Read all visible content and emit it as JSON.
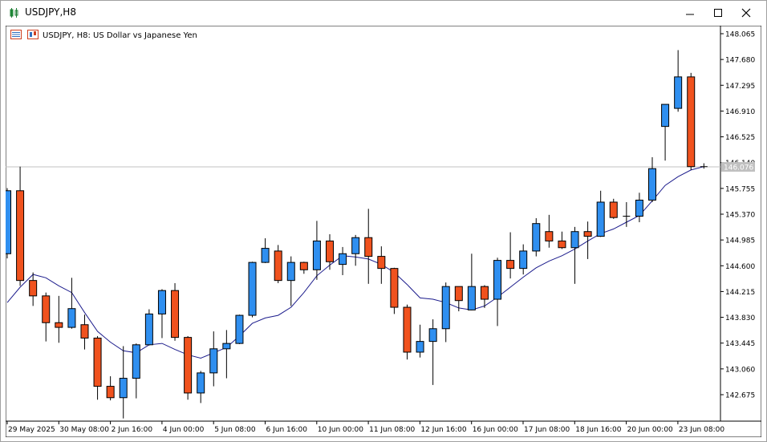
{
  "window": {
    "title": "USDJPY,H8"
  },
  "chart_header": {
    "text": "USDJPY, H8:  US Dollar vs Japanese Yen"
  },
  "colors": {
    "bull": "#2f8ff0",
    "bear": "#f0521e",
    "candle_outline": "#000000",
    "ma_line": "#1c1c8c",
    "price_line": "#c0c0c0",
    "price_tag_bg": "#c0c0c0",
    "price_tag_text": "#ffffff"
  },
  "chart_data": {
    "type": "candlestick",
    "symbol": "USDJPY",
    "timeframe": "H8",
    "ylim": [
      142.1,
      148.3
    ],
    "y_ticks": [
      "148.065",
      "147.680",
      "147.295",
      "146.910",
      "146.525",
      "146.140",
      "145.755",
      "145.370",
      "144.985",
      "144.600",
      "144.215",
      "143.830",
      "143.445",
      "143.060",
      "142.675"
    ],
    "x_ticks": [
      "29 May 2025",
      "30 May 08:00",
      "2 Jun 16:00",
      "4 Jun 00:00",
      "5 Jun 08:00",
      "6 Jun 16:00",
      "10 Jun 00:00",
      "11 Jun 08:00",
      "12 Jun 16:00",
      "16 Jun 00:00",
      "17 Jun 08:00",
      "18 Jun 16:00",
      "20 Jun 00:00",
      "23 Jun 08:00"
    ],
    "current_price": "146.076",
    "candles": [
      {
        "o": 144.78,
        "h": 145.76,
        "l": 144.71,
        "c": 145.72
      },
      {
        "o": 145.72,
        "h": 146.08,
        "l": 144.3,
        "c": 144.38
      },
      {
        "o": 144.38,
        "h": 144.5,
        "l": 144.0,
        "c": 144.15
      },
      {
        "o": 144.15,
        "h": 144.2,
        "l": 143.47,
        "c": 143.75
      },
      {
        "o": 143.75,
        "h": 144.15,
        "l": 143.45,
        "c": 143.68
      },
      {
        "o": 143.68,
        "h": 144.42,
        "l": 143.66,
        "c": 143.96
      },
      {
        "o": 143.72,
        "h": 143.87,
        "l": 143.35,
        "c": 143.52
      },
      {
        "o": 143.52,
        "h": 143.55,
        "l": 142.6,
        "c": 142.8
      },
      {
        "o": 142.8,
        "h": 142.95,
        "l": 142.59,
        "c": 142.63
      },
      {
        "o": 142.63,
        "h": 143.4,
        "l": 142.32,
        "c": 142.92
      },
      {
        "o": 142.92,
        "h": 143.44,
        "l": 142.62,
        "c": 143.42
      },
      {
        "o": 143.42,
        "h": 143.95,
        "l": 143.41,
        "c": 143.88
      },
      {
        "o": 143.88,
        "h": 144.25,
        "l": 143.52,
        "c": 144.23
      },
      {
        "o": 144.23,
        "h": 144.34,
        "l": 143.48,
        "c": 143.53
      },
      {
        "o": 143.53,
        "h": 143.55,
        "l": 142.6,
        "c": 142.7
      },
      {
        "o": 142.7,
        "h": 143.03,
        "l": 142.55,
        "c": 143.0
      },
      {
        "o": 143.0,
        "h": 143.62,
        "l": 142.8,
        "c": 143.36
      },
      {
        "o": 143.36,
        "h": 143.64,
        "l": 142.92,
        "c": 143.44
      },
      {
        "o": 143.44,
        "h": 143.87,
        "l": 143.43,
        "c": 143.86
      },
      {
        "o": 143.86,
        "h": 144.66,
        "l": 143.83,
        "c": 144.65
      },
      {
        "o": 144.65,
        "h": 145.01,
        "l": 144.64,
        "c": 144.86
      },
      {
        "o": 144.82,
        "h": 144.91,
        "l": 144.34,
        "c": 144.38
      },
      {
        "o": 144.38,
        "h": 144.74,
        "l": 144.0,
        "c": 144.65
      },
      {
        "o": 144.65,
        "h": 144.66,
        "l": 144.48,
        "c": 144.54
      },
      {
        "o": 144.54,
        "h": 145.27,
        "l": 144.39,
        "c": 144.97
      },
      {
        "o": 144.97,
        "h": 145.07,
        "l": 144.54,
        "c": 144.66
      },
      {
        "o": 144.62,
        "h": 144.88,
        "l": 144.46,
        "c": 144.78
      },
      {
        "o": 144.78,
        "h": 145.06,
        "l": 144.6,
        "c": 145.02
      },
      {
        "o": 145.02,
        "h": 145.45,
        "l": 144.33,
        "c": 144.74
      },
      {
        "o": 144.74,
        "h": 144.89,
        "l": 144.33,
        "c": 144.56
      },
      {
        "o": 144.56,
        "h": 144.57,
        "l": 143.88,
        "c": 143.98
      },
      {
        "o": 143.98,
        "h": 144.02,
        "l": 143.2,
        "c": 143.31
      },
      {
        "o": 143.31,
        "h": 143.72,
        "l": 143.23,
        "c": 143.47
      },
      {
        "o": 143.47,
        "h": 143.8,
        "l": 142.82,
        "c": 143.66
      },
      {
        "o": 143.66,
        "h": 144.35,
        "l": 143.46,
        "c": 144.29
      },
      {
        "o": 144.29,
        "h": 144.29,
        "l": 143.92,
        "c": 144.08
      },
      {
        "o": 143.94,
        "h": 144.78,
        "l": 143.94,
        "c": 144.29
      },
      {
        "o": 144.29,
        "h": 144.31,
        "l": 143.97,
        "c": 144.1
      },
      {
        "o": 144.1,
        "h": 144.72,
        "l": 143.7,
        "c": 144.68
      },
      {
        "o": 144.68,
        "h": 145.1,
        "l": 144.41,
        "c": 144.56
      },
      {
        "o": 144.56,
        "h": 144.92,
        "l": 144.47,
        "c": 144.82
      },
      {
        "o": 144.82,
        "h": 145.31,
        "l": 144.74,
        "c": 145.23
      },
      {
        "o": 145.11,
        "h": 145.36,
        "l": 144.87,
        "c": 144.97
      },
      {
        "o": 144.97,
        "h": 145.11,
        "l": 144.85,
        "c": 144.87
      },
      {
        "o": 144.87,
        "h": 145.18,
        "l": 144.33,
        "c": 145.11
      },
      {
        "o": 145.11,
        "h": 145.26,
        "l": 144.7,
        "c": 145.04
      },
      {
        "o": 145.04,
        "h": 145.72,
        "l": 145.03,
        "c": 145.55
      },
      {
        "o": 145.55,
        "h": 145.6,
        "l": 145.3,
        "c": 145.32
      },
      {
        "o": 145.33,
        "h": 145.55,
        "l": 145.18,
        "c": 145.34
      },
      {
        "o": 145.34,
        "h": 145.69,
        "l": 145.25,
        "c": 145.58
      },
      {
        "o": 145.58,
        "h": 146.22,
        "l": 145.55,
        "c": 146.05
      },
      {
        "o": 146.68,
        "h": 147.01,
        "l": 146.17,
        "c": 147.01
      },
      {
        "o": 146.95,
        "h": 147.82,
        "l": 146.9,
        "c": 147.42
      },
      {
        "o": 147.42,
        "h": 147.48,
        "l": 146.03,
        "c": 146.08
      },
      {
        "o": 146.08,
        "h": 146.13,
        "l": 146.05,
        "c": 146.08
      }
    ],
    "ma_period": 14,
    "ma": [
      144.05,
      144.28,
      144.47,
      144.42,
      144.3,
      144.2,
      143.9,
      143.62,
      143.46,
      143.33,
      143.3,
      143.42,
      143.44,
      143.35,
      143.27,
      143.22,
      143.3,
      143.38,
      143.55,
      143.74,
      143.82,
      143.86,
      143.98,
      144.2,
      144.45,
      144.61,
      144.75,
      144.73,
      144.7,
      144.62,
      144.5,
      144.32,
      144.12,
      144.1,
      144.05,
      143.97,
      143.94,
      144.0,
      144.13,
      144.28,
      144.43,
      144.57,
      144.67,
      144.75,
      144.85,
      144.97,
      145.08,
      145.15,
      145.25,
      145.35,
      145.57,
      145.8,
      145.93,
      146.03,
      146.08
    ]
  }
}
